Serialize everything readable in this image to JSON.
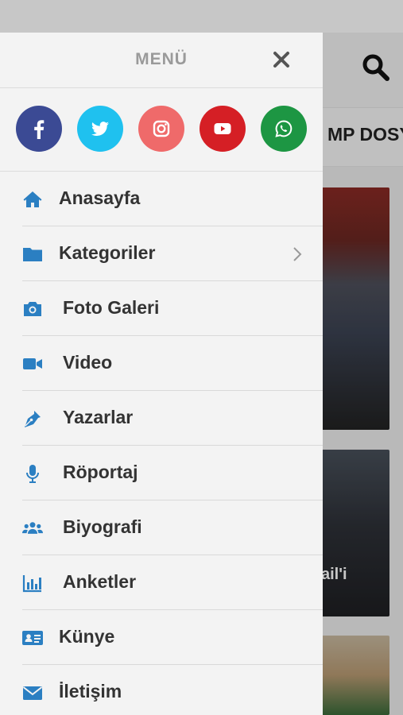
{
  "colors": {
    "accent": "#2b7fc2",
    "drawer_bg": "#f3f3f3",
    "facebook": "#3b4a94",
    "twitter": "#1fc1ef",
    "instagram": "#ef6a6a",
    "youtube": "#d51f25",
    "whatsapp": "#1d9643"
  },
  "drawer": {
    "title": "MENÜ",
    "close_icon": "close-icon",
    "social": [
      {
        "name": "facebook",
        "icon": "facebook-icon"
      },
      {
        "name": "twitter",
        "icon": "twitter-icon"
      },
      {
        "name": "instagram",
        "icon": "instagram-icon"
      },
      {
        "name": "youtube",
        "icon": "youtube-icon"
      },
      {
        "name": "whatsapp",
        "icon": "whatsapp-icon"
      }
    ],
    "items": [
      {
        "label": "Anasayfa",
        "icon": "home-icon"
      },
      {
        "label": "Kategoriler",
        "icon": "folder-icon",
        "has_submenu": true
      },
      {
        "label": "Foto Galeri",
        "icon": "camera-icon"
      },
      {
        "label": "Video",
        "icon": "video-camera-icon"
      },
      {
        "label": "Yazarlar",
        "icon": "pen-nib-icon"
      },
      {
        "label": "Röportaj",
        "icon": "microphone-icon"
      },
      {
        "label": "Biyografi",
        "icon": "users-icon"
      },
      {
        "label": "Anketler",
        "icon": "bar-chart-icon"
      },
      {
        "label": "Künye",
        "icon": "id-card-icon"
      },
      {
        "label": "İletişim",
        "icon": "envelope-icon"
      }
    ]
  },
  "background": {
    "nav_text": "MP DOSY",
    "card_text": "ail'i",
    "search_icon": "search-icon"
  }
}
